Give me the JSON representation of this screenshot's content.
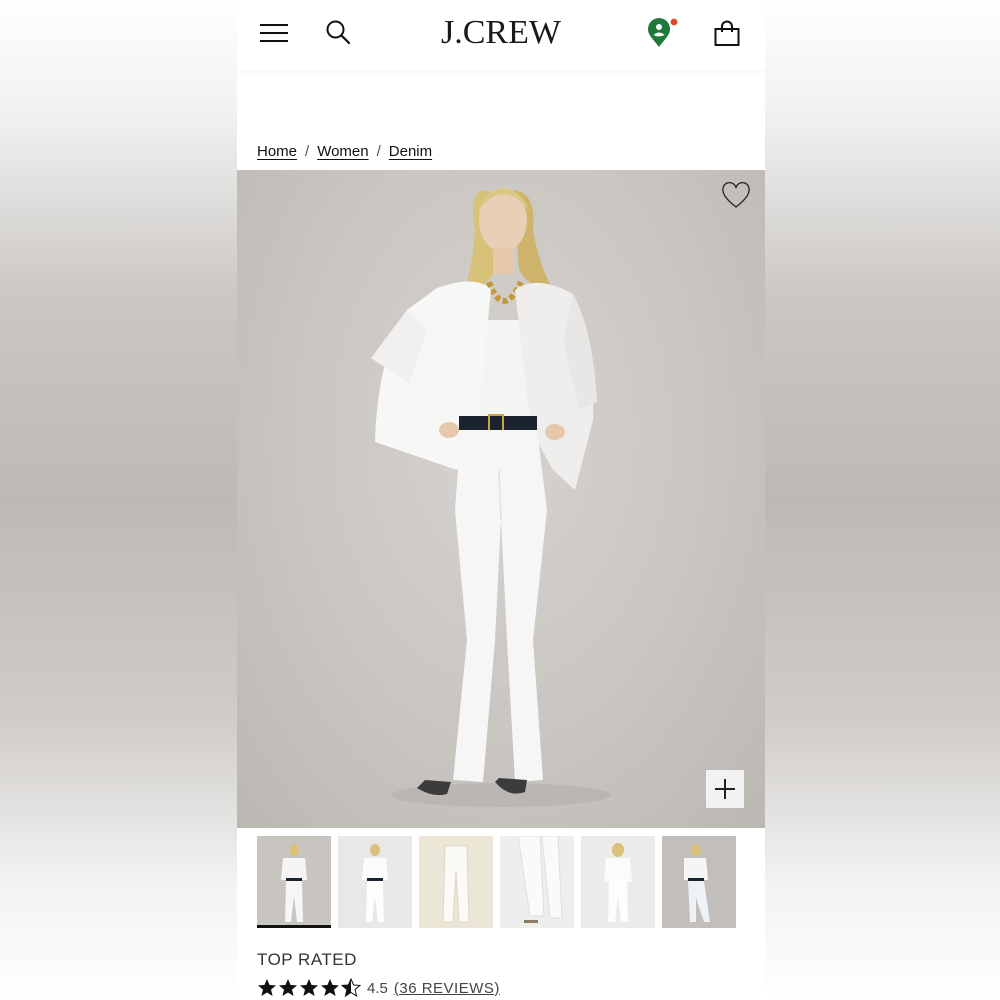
{
  "header": {
    "logo": "J.CREW",
    "menu_icon": "hamburger-menu-icon",
    "search_icon": "search-icon",
    "location_icon": "location-pin-icon",
    "bag_icon": "shopping-bag-icon",
    "location_color": "#1f7a3a",
    "notification_dot_color": "#e0442a"
  },
  "breadcrumb": {
    "items": [
      "Home",
      "Women",
      "Denim"
    ],
    "separator": "/"
  },
  "product": {
    "image_alt": "Model wearing white denim jacket and white flare jeans",
    "wishlist_icon": "heart-icon",
    "zoom_icon": "plus-icon",
    "thumbnails_count": 6,
    "active_thumbnail": 1,
    "badge": "TOP RATED",
    "rating_value": "4.5",
    "rating_stars": 4.5,
    "reviews_label": "(36 REVIEWS)"
  }
}
